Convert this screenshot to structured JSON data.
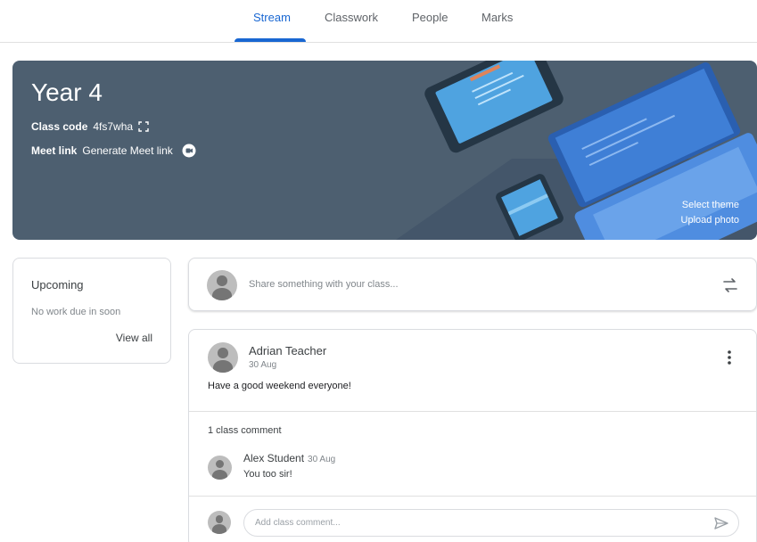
{
  "nav": {
    "tabs": [
      {
        "label": "Stream",
        "active": true
      },
      {
        "label": "Classwork",
        "active": false
      },
      {
        "label": "People",
        "active": false
      },
      {
        "label": "Marks",
        "active": false
      }
    ]
  },
  "banner": {
    "title": "Year 4",
    "class_code_label": "Class code",
    "class_code": "4fs7wha",
    "meet_label": "Meet link",
    "meet_action": "Generate Meet link",
    "select_theme": "Select theme",
    "upload_photo": "Upload photo",
    "color": "#4d5f70"
  },
  "upcoming": {
    "title": "Upcoming",
    "subtitle": "No work due in soon",
    "view_all": "View all"
  },
  "share": {
    "placeholder": "Share something with your class..."
  },
  "post": {
    "author": "Adrian Teacher",
    "date": "30 Aug",
    "body": "Have a good weekend everyone!",
    "comment_count": "1 class comment",
    "comments": [
      {
        "author": "Alex Student",
        "date": "30 Aug",
        "body": "You too sir!"
      }
    ],
    "comment_placeholder": "Add class comment..."
  },
  "colors": {
    "accent": "#1967d2",
    "border": "#dadce0"
  }
}
